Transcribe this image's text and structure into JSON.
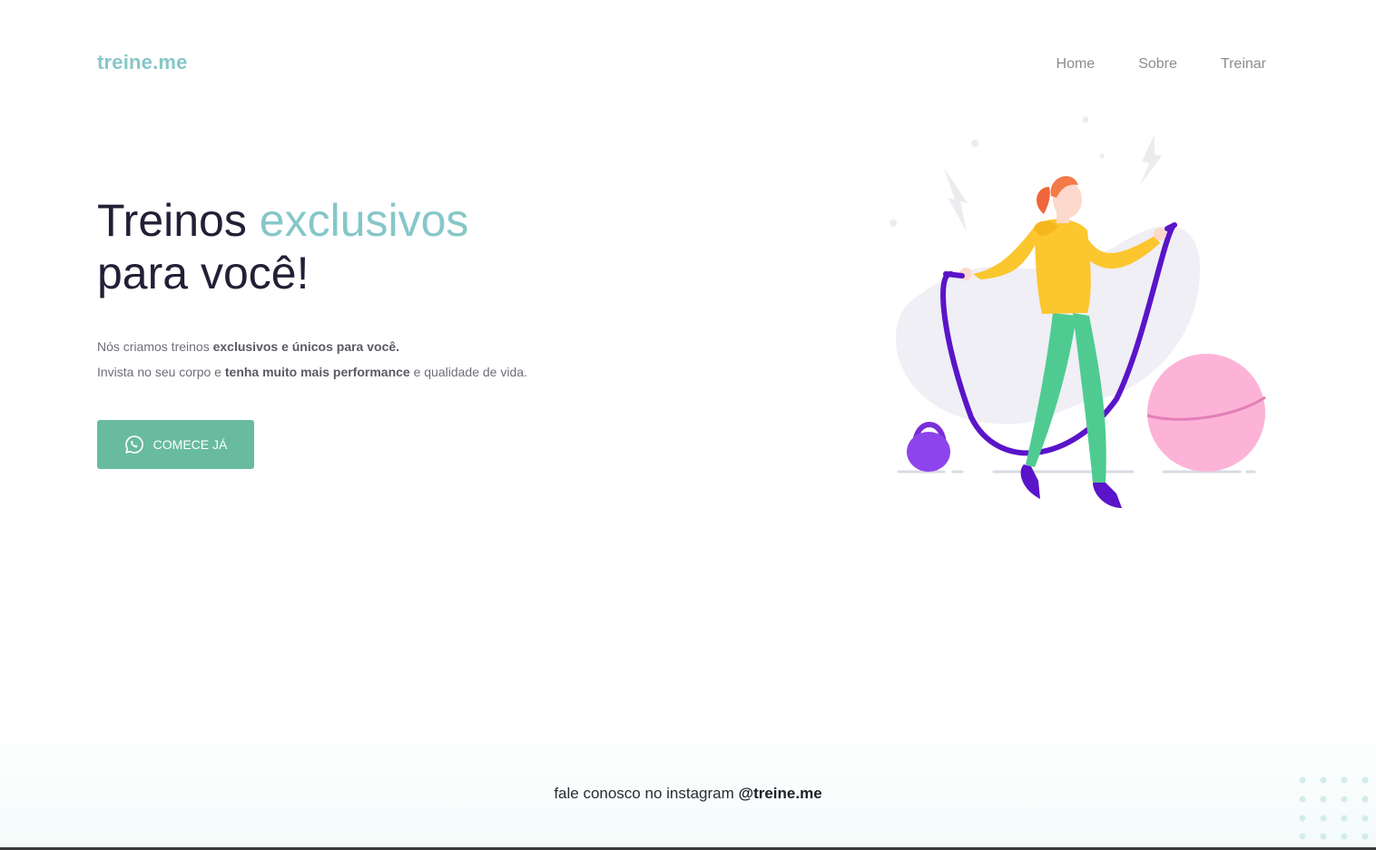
{
  "brand": {
    "logo": "treine.me"
  },
  "nav": {
    "items": [
      "Home",
      "Sobre",
      "Treinar"
    ]
  },
  "hero": {
    "title_part1": "Treinos",
    "title_accent": "exclusivos",
    "title_part2": "para você!",
    "line1_prefix": "Nós criamos treinos",
    "line1_bold": "exclusivos e únicos para você.",
    "line2_prefix": "Invista no seu corpo e",
    "line2_bold": "tenha muito mais performance",
    "line2_suffix": "e qualidade de vida.",
    "cta_label": "COMECE JÁ",
    "cta_icon": "whatsapp-icon"
  },
  "footer": {
    "prefix": "fale conosco no instagram",
    "handle": "@treine.me"
  },
  "colors": {
    "accent": "#86c7c8",
    "button": "#68bb9e",
    "heading": "#221f36"
  }
}
